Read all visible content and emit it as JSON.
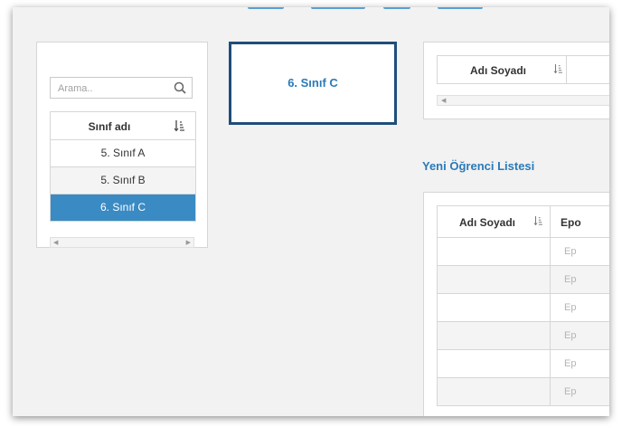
{
  "search": {
    "placeholder": "Arama.."
  },
  "class_table": {
    "header": "Sınıf adı",
    "rows": [
      {
        "label": "5. Sınıf A"
      },
      {
        "label": "5. Sınıf B"
      },
      {
        "label": "6. Sınıf C"
      }
    ],
    "selected_index": 2
  },
  "selected_class": {
    "label": "6. Sınıf C"
  },
  "top_table": {
    "col1": "Adı Soyadı"
  },
  "new_list": {
    "title": "Yeni Öğrenci Listesi",
    "col1": "Adı Soyadı",
    "col2": "Epo",
    "rows": [
      "Ep",
      "Ep",
      "Ep",
      "Ep",
      "Ep",
      "Ep"
    ]
  },
  "colors": {
    "accent": "#2a7ab8",
    "selected_row": "#3a8ac4",
    "selected_border": "#1f4e7a"
  },
  "icons": {
    "search": "search-icon",
    "sort": "sort-icon",
    "scroll_left": "arrow-left-icon",
    "scroll_right": "arrow-right-icon"
  }
}
